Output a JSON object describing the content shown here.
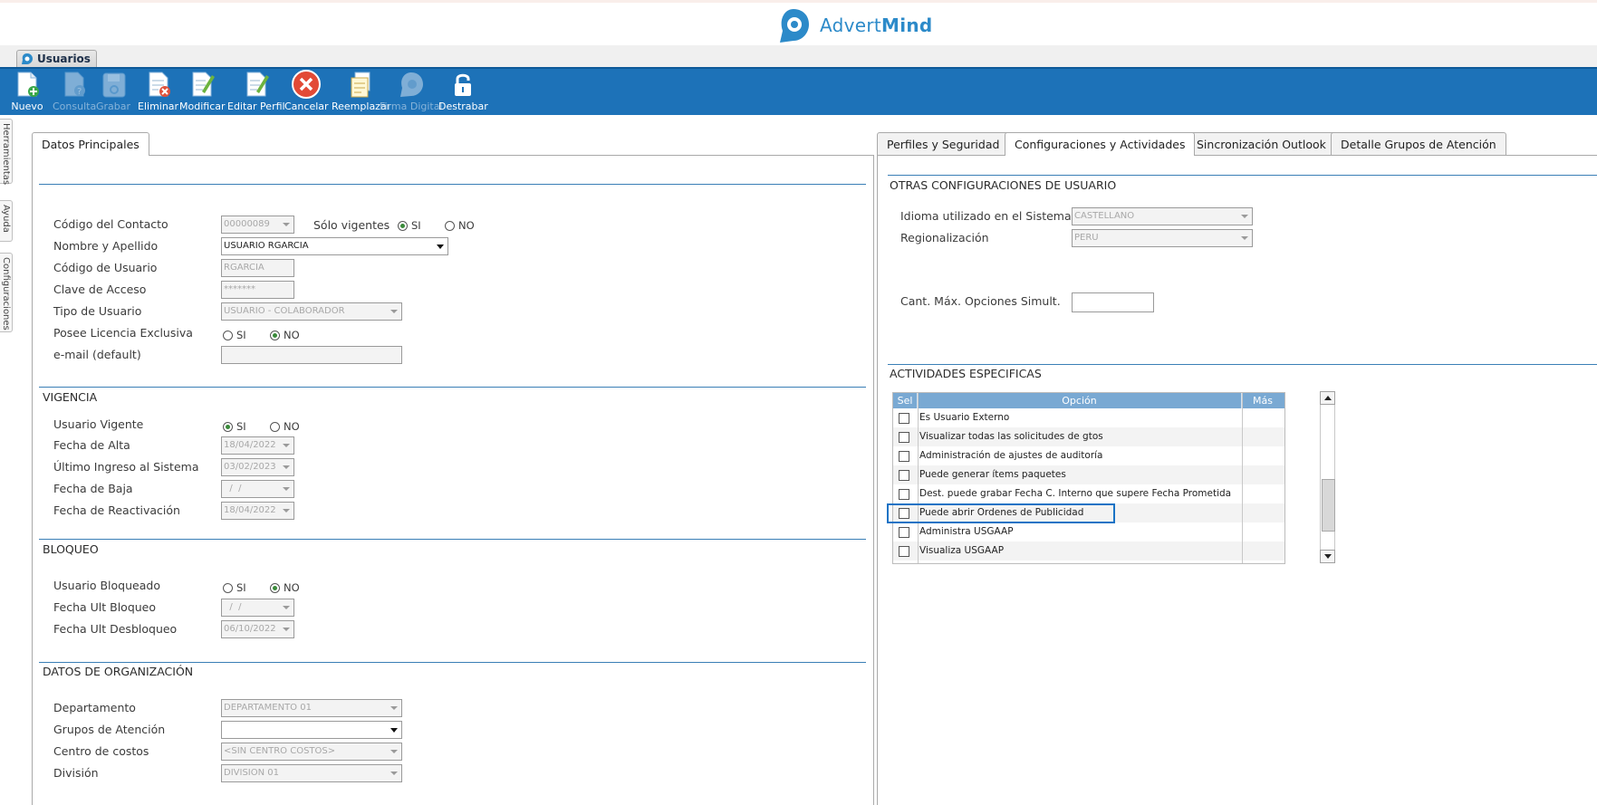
{
  "brand": {
    "name_regular": "Advert",
    "name_bold": "Mind"
  },
  "window_tab": {
    "label": "Usuarios"
  },
  "toolbar": {
    "nuevo": "Nuevo",
    "consulta": "Consulta",
    "grabar": "Grabar",
    "eliminar": "Eliminar",
    "modificar": "Modificar",
    "editar_perfil": "Editar Perfil",
    "cancelar": "Cancelar",
    "reemplazar": "Reemplazar",
    "firma_digital": "Firma Digital",
    "destrabar": "Destrabar"
  },
  "side_tabs": {
    "herramientas": "Herramientas",
    "ayuda": "Ayuda",
    "configuraciones": "Configuraciones"
  },
  "left_tab": "Datos Principales",
  "right_tabs": [
    "Perfiles y Seguridad",
    "Configuraciones y Actividades",
    "Sincronización Outlook",
    "Detalle Grupos de Atención"
  ],
  "main": {
    "codigo_contacto": {
      "label": "Código del Contacto",
      "value": "00000089"
    },
    "solo_vigentes": {
      "label": "Sólo vigentes",
      "si": "SI",
      "no": "NO",
      "selected": "SI"
    },
    "nombre_apellido": {
      "label": "Nombre y Apellido",
      "value": "USUARIO RGARCIA"
    },
    "codigo_usuario": {
      "label": "Código de Usuario",
      "value": "RGARCIA"
    },
    "clave_acceso": {
      "label": "Clave de Acceso",
      "value": "*******"
    },
    "tipo_usuario": {
      "label": "Tipo de Usuario",
      "value": "USUARIO - COLABORADOR"
    },
    "licencia_exclusiva": {
      "label": "Posee Licencia Exclusiva",
      "si": "SI",
      "no": "NO",
      "selected": "NO"
    },
    "email": {
      "label": "e-mail (default)",
      "value": ""
    }
  },
  "vigencia": {
    "title": "VIGENCIA",
    "usuario_vigente": {
      "label": "Usuario Vigente",
      "si": "SI",
      "no": "NO",
      "selected": "SI"
    },
    "fecha_alta": {
      "label": "Fecha de Alta",
      "value": "18/04/2022"
    },
    "ultimo_ingreso": {
      "label": "Último Ingreso al Sistema",
      "value": "03/02/2023"
    },
    "fecha_baja": {
      "label": "Fecha de Baja",
      "value": "  /  /"
    },
    "fecha_reactivacion": {
      "label": "Fecha de Reactivación",
      "value": "18/04/2022"
    }
  },
  "bloqueo": {
    "title": "BLOQUEO",
    "usuario_bloqueado": {
      "label": "Usuario Bloqueado",
      "si": "SI",
      "no": "NO",
      "selected": "NO"
    },
    "fecha_ult_bloqueo": {
      "label": "Fecha Ult Bloqueo",
      "value": "  /  /"
    },
    "fecha_ult_desbloqueo": {
      "label": "Fecha Ult Desbloqueo",
      "value": "06/10/2022"
    }
  },
  "organizacion": {
    "title": "DATOS DE ORGANIZACIÓN",
    "departamento": {
      "label": "Departamento",
      "value": "DEPARTAMENTO 01"
    },
    "grupos_atencion": {
      "label": "Grupos de Atención",
      "value": ""
    },
    "centro_costos": {
      "label": "Centro de costos",
      "value": "<SIN CENTRO COSTOS>"
    },
    "division": {
      "label": "División",
      "value": "DIVISION 01"
    }
  },
  "otras_config": {
    "title": "OTRAS CONFIGURACIONES DE USUARIO",
    "idioma": {
      "label": "Idioma utilizado en el Sistema",
      "value": "CASTELLANO"
    },
    "regionalizacion": {
      "label": "Regionalización",
      "value": "PERU"
    },
    "cant_max": {
      "label": "Cant. Máx. Opciones Simult.",
      "value": ""
    }
  },
  "actividades": {
    "title": "ACTIVIDADES ESPECIFICAS",
    "columns": {
      "sel": "Sel",
      "opcion": "Opción",
      "mas": "Más"
    },
    "rows": [
      {
        "opcion": "Es Usuario Externo",
        "checked": false
      },
      {
        "opcion": "Visualizar todas las solicitudes de gtos",
        "checked": false
      },
      {
        "opcion": "Administración de ajustes de auditoría",
        "checked": false
      },
      {
        "opcion": "Puede generar ítems paquetes",
        "checked": false
      },
      {
        "opcion": "Dest. puede grabar Fecha C. Interno que supere Fecha Prometida",
        "checked": false
      },
      {
        "opcion": "Puede abrir Ordenes de Publicidad",
        "checked": false
      },
      {
        "opcion": "Administra USGAAP",
        "checked": false
      },
      {
        "opcion": "Visualiza USGAAP",
        "checked": false
      }
    ]
  },
  "colors": {
    "toolbar": "#1d72b8",
    "accent": "#2c8ac9",
    "grid_header": "#79a9d3",
    "separator": "#3a7fb6"
  }
}
